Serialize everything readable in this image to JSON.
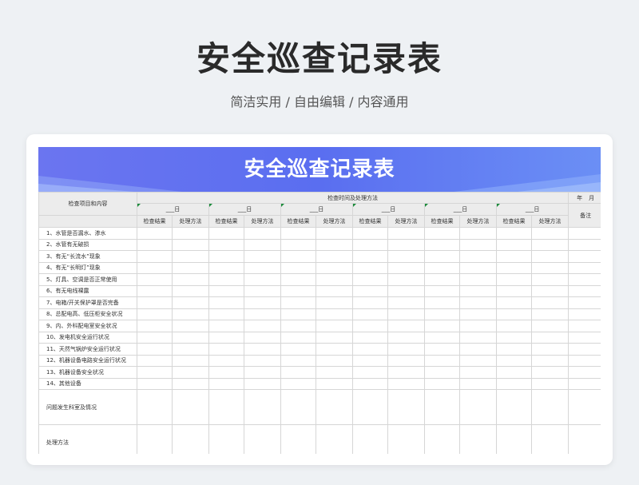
{
  "page": {
    "title": "安全巡查记录表",
    "subtitle": "简洁实用 / 自由编辑 / 内容通用"
  },
  "sheet": {
    "banner_title": "安全巡查记录表",
    "col_item_header": "检查项目和内容",
    "time_header": "检查时间及处理方法",
    "year": "年",
    "month": "月",
    "day": "日",
    "date_label": "___日",
    "result_header": "检查结果",
    "method_header": "处理方法",
    "remark_header": "备注",
    "items": [
      "1、水管是否漏水、渗水",
      "2、水管有无破损",
      "3、有无“长流水”现象",
      "4、有无“长明灯”现象",
      "5、灯具、空调是否正常使用",
      "6、有无电线裸露",
      "7、电箱/开关保护罩是否完备",
      "8、总配电高、低压柜安全状况",
      "9、内、外科配电室安全状况",
      "10、发电机安全运行状况",
      "11、天然气锅炉安全运行状况",
      "12、机器设备电路安全运行状况",
      "13、机器设备安全状况",
      "14、其他设备"
    ],
    "problem_label": "问题发生科室及情况",
    "solution_label": "处理方法"
  },
  "colors": {
    "banner_start": "#6b75f0",
    "banner_end": "#6b8ff5",
    "header_bg": "#ececec",
    "page_bg": "#eef1f4",
    "marker": "#1a8a3a"
  }
}
